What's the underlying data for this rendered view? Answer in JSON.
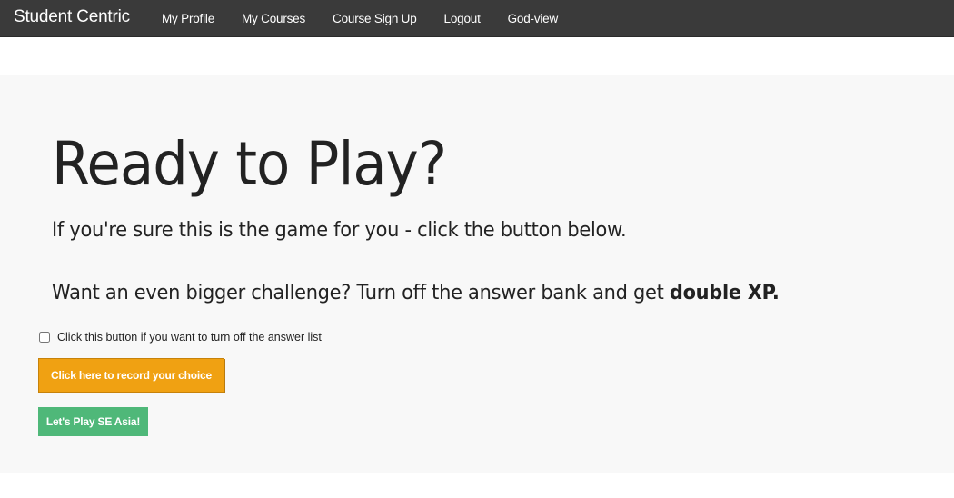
{
  "navbar": {
    "brand": "Student Centric",
    "links": [
      {
        "label": "My Profile"
      },
      {
        "label": "My Courses"
      },
      {
        "label": "Course Sign Up"
      },
      {
        "label": "Logout"
      },
      {
        "label": "God-view"
      }
    ]
  },
  "main": {
    "title": "Ready to Play?",
    "lead1": "If you're sure this is the game for you - click the button below.",
    "lead2_prefix": "Want an even bigger challenge? Turn off the answer bank and get ",
    "lead2_bold": "double XP.",
    "checkbox": {
      "label": "Click this button if you want to turn off the answer list",
      "checked": false
    },
    "record_button": "Click here to record your choice",
    "play_button": "Let's Play SE Asia!"
  },
  "colors": {
    "navbar_bg": "#3a3a3a",
    "record_button": "#f0a112",
    "play_button": "#4fb879",
    "jumbotron_bg": "#f8f8f8"
  }
}
